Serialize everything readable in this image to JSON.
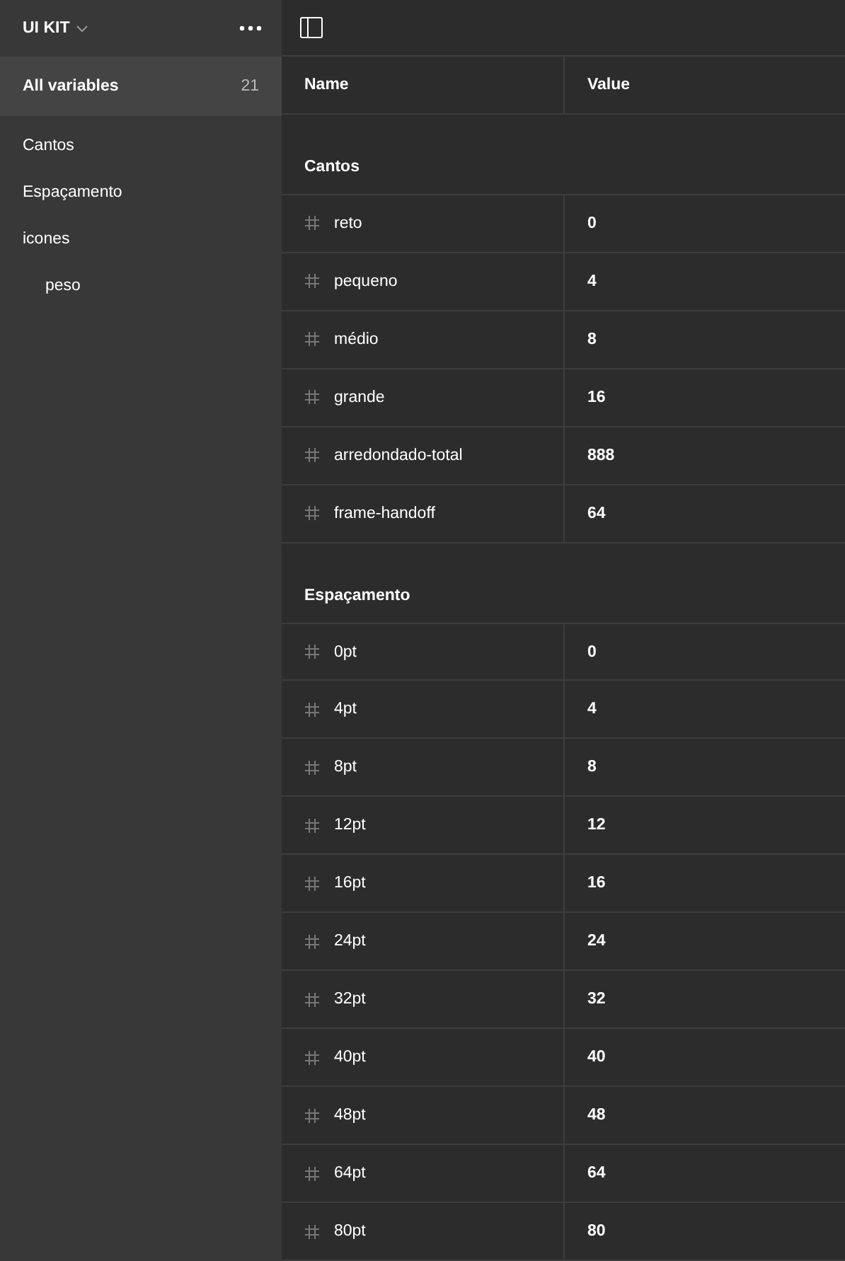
{
  "sidebar": {
    "title": "UI KIT",
    "all": {
      "label": "All variables",
      "count": "21",
      "selected": true
    },
    "groups": [
      {
        "label": "Cantos",
        "selected": false
      },
      {
        "label": "Espaçamento",
        "selected": false
      },
      {
        "label": "icones",
        "selected": false,
        "children": [
          {
            "label": "peso",
            "selected": false
          }
        ]
      }
    ]
  },
  "table": {
    "columns": [
      "Name",
      "Value"
    ],
    "groups": [
      {
        "title": "Cantos",
        "rows": [
          {
            "name": "reto",
            "value": "0"
          },
          {
            "name": "pequeno",
            "value": "4"
          },
          {
            "name": "médio",
            "value": "8"
          },
          {
            "name": "grande",
            "value": "16"
          },
          {
            "name": "arredondado-total",
            "value": "888"
          },
          {
            "name": "frame-handoff",
            "value": "64"
          }
        ]
      },
      {
        "title": "Espaçamento",
        "rows": [
          {
            "name": "0pt",
            "value": "0"
          },
          {
            "name": "4pt",
            "value": "4"
          },
          {
            "name": "8pt",
            "value": "8"
          },
          {
            "name": "12pt",
            "value": "12"
          },
          {
            "name": "16pt",
            "value": "16"
          },
          {
            "name": "24pt",
            "value": "24"
          },
          {
            "name": "32pt",
            "value": "32"
          },
          {
            "name": "40pt",
            "value": "40"
          },
          {
            "name": "48pt",
            "value": "48"
          },
          {
            "name": "64pt",
            "value": "64"
          },
          {
            "name": "80pt",
            "value": "80"
          }
        ]
      }
    ]
  }
}
